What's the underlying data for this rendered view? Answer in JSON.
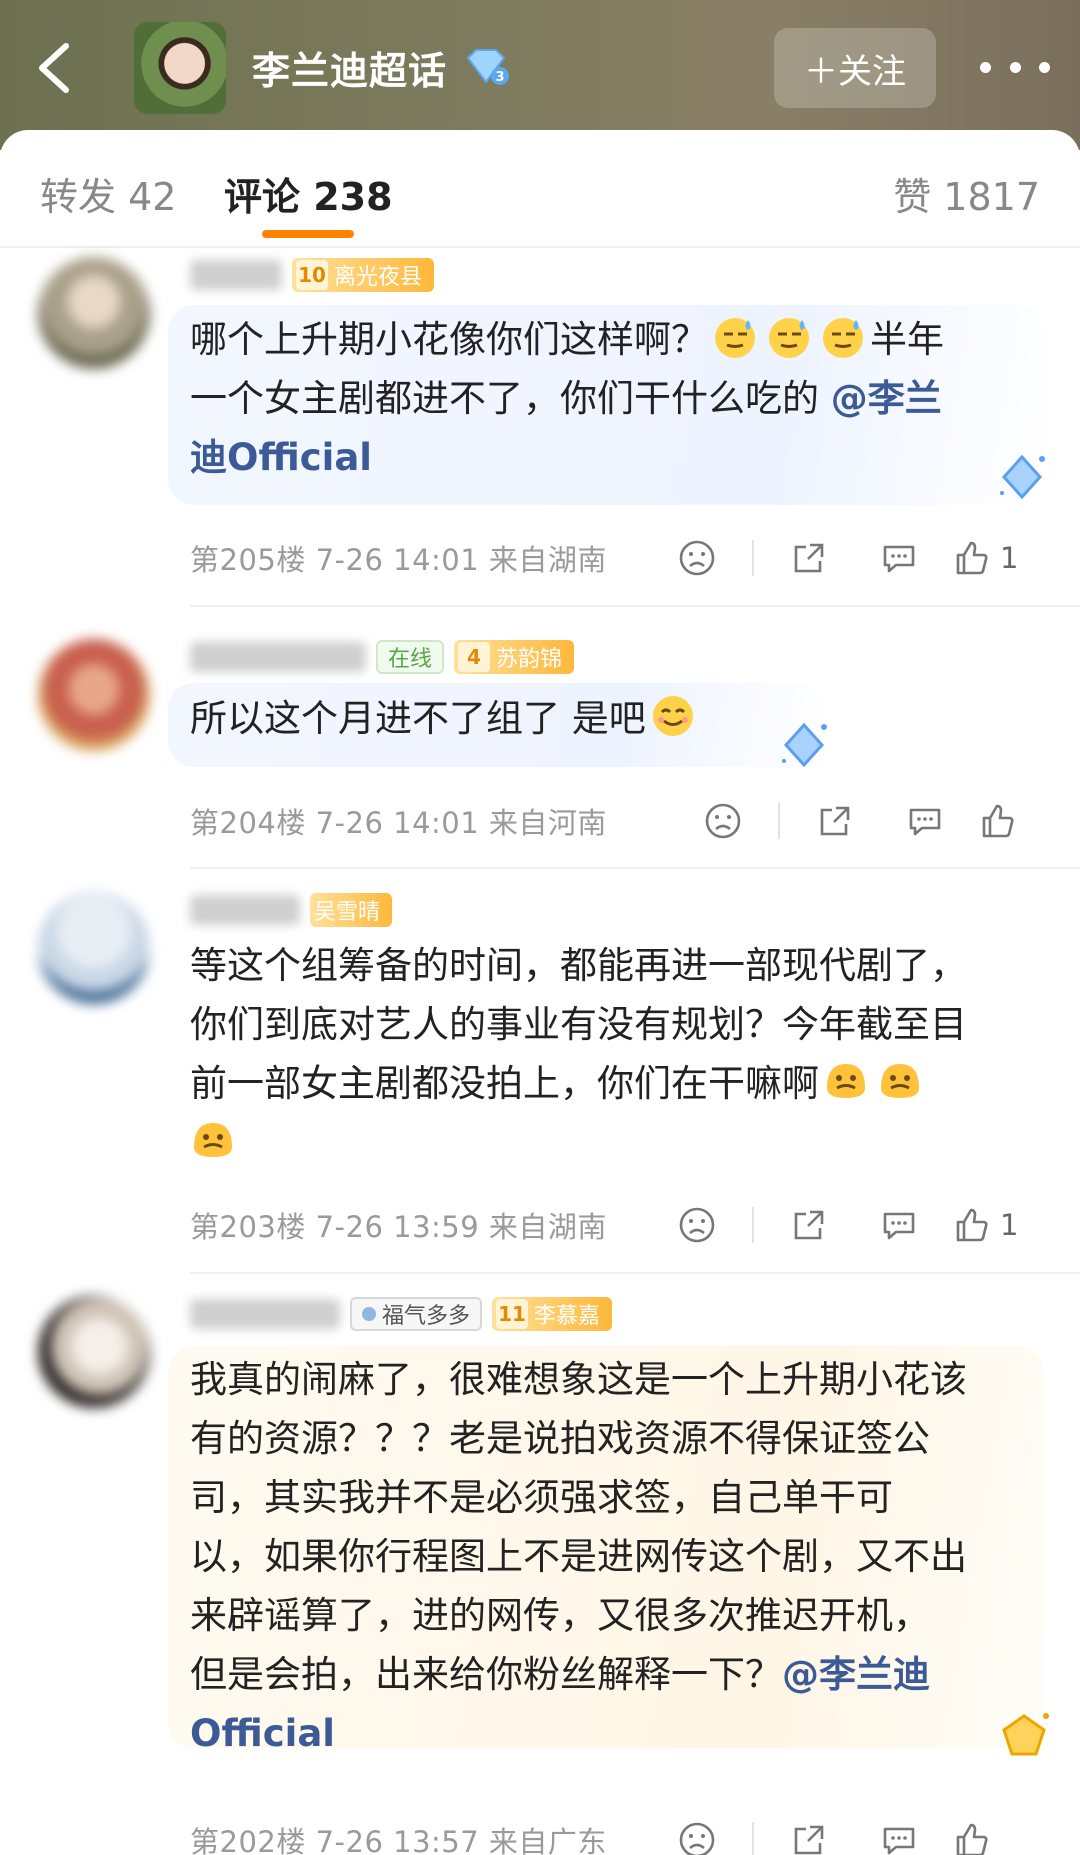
{
  "header": {
    "title": "李兰迪超话",
    "follow_label": "＋关注",
    "back_icon": "back-arrow-icon",
    "more_icon": "more-dots-icon"
  },
  "tabs": {
    "repost": "转发 42",
    "comment": "评论 238",
    "like": "赞 1817"
  },
  "colors": {
    "accent": "#ff8200",
    "mention": "#3c5b96",
    "meta": "#9a9a9a"
  },
  "comments": [
    {
      "badges": [
        {
          "level": "10",
          "name": "离光夜县"
        }
      ],
      "text_parts": [
        "哪个上升期小花像你们这样啊？",
        "半年",
        "一个女主剧都进不了，你们干什么吃的 ",
        "@李兰",
        "迪Official"
      ],
      "floor": "第205楼",
      "time": "7-26 14:01",
      "location": "来自湖南",
      "like_count": "1"
    },
    {
      "online": "在线",
      "badges": [
        {
          "level": "4",
          "name": "苏韵锦"
        }
      ],
      "text_parts": [
        "所以这个月进不了组了 是吧"
      ],
      "floor": "第204楼",
      "time": "7-26 14:01",
      "location": "来自河南",
      "like_count": ""
    },
    {
      "badges": [
        {
          "level": "",
          "name": "吴雪晴"
        }
      ],
      "text_parts": [
        "等这个组筹备的时间，都能再进一部现代剧了，",
        "你们到底对艺人的事业有没有规划？今年截至目",
        "前一部女主剧都没拍上，你们在干嘛啊"
      ],
      "floor": "第203楼",
      "time": "7-26 13:59",
      "location": "来自湖南",
      "like_count": "1"
    },
    {
      "fan_badge": "福气多多",
      "badges": [
        {
          "level": "11",
          "name": "李慕嘉"
        }
      ],
      "text_parts": [
        "我真的闹麻了，很难想象这是一个上升期小花该",
        "有的资源？？？老是说拍戏资源不得保证签公",
        "司，其实我并不是必须强求签，自己单干可",
        "以，如果你行程图上不是进网传这个剧，又不出",
        "来辟谣算了，进的网传，又很多次推迟开机，",
        "但是会拍，出来给你粉丝解释一下？",
        "@李兰迪",
        "Official"
      ],
      "floor": "第202楼",
      "time": "7-26 13:57",
      "location": "来自广东",
      "like_count": ""
    }
  ]
}
